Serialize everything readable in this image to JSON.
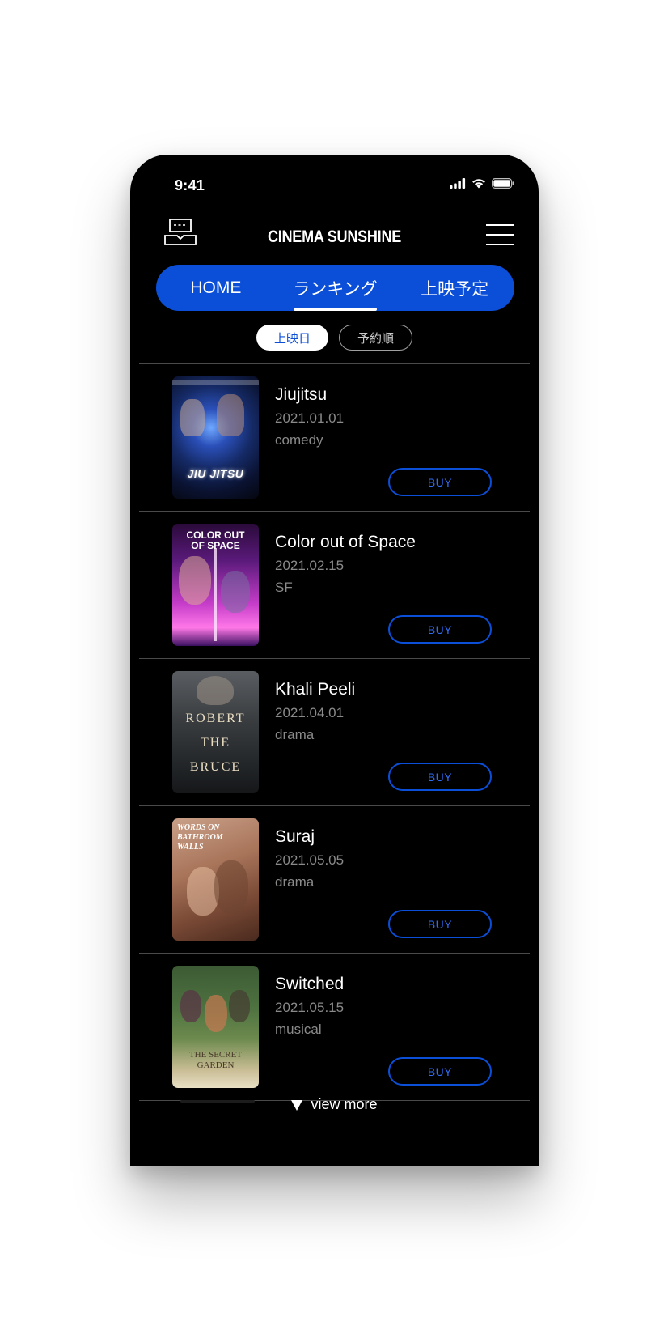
{
  "status_bar": {
    "time": "9:41"
  },
  "header": {
    "brand": "CINEMA SUNSHINE",
    "logo_icon": "ticket-icon",
    "menu_icon": "hamburger-menu-icon"
  },
  "tabs": [
    {
      "label": "HOME",
      "active": false
    },
    {
      "label": "ランキング",
      "active": true
    },
    {
      "label": "上映予定",
      "active": false
    }
  ],
  "sort": {
    "active_label": "上映日",
    "inactive_label": "予約順"
  },
  "movies": [
    {
      "title": "Jiujitsu",
      "date": "2021.01.01",
      "genre": "comedy",
      "buy_label": "BUY",
      "poster_text": "JIU JITSU"
    },
    {
      "title": "Color out of Space",
      "date": "2021.02.15",
      "genre": "SF",
      "buy_label": "BUY",
      "poster_text": "COLOR OUT OF SPACE"
    },
    {
      "title": "Khali Peeli",
      "date": "2021.04.01",
      "genre": "drama",
      "buy_label": "BUY",
      "poster_text_1": "ROBERT",
      "poster_text_2": "THE",
      "poster_text_3": "BRUCE"
    },
    {
      "title": "Suraj",
      "date": "2021.05.05",
      "genre": "drama",
      "buy_label": "BUY",
      "poster_text": "WORDS ON BATHROOM WALLS"
    },
    {
      "title": "Switched",
      "date": "2021.05.15",
      "genre": "musical",
      "buy_label": "BUY",
      "poster_text": "THE SECRET GARDEN"
    }
  ],
  "view_more": {
    "label": "view more"
  },
  "colors": {
    "accent": "#0b4fd8",
    "background": "#000000",
    "secondary_text": "#8a8a8a"
  }
}
